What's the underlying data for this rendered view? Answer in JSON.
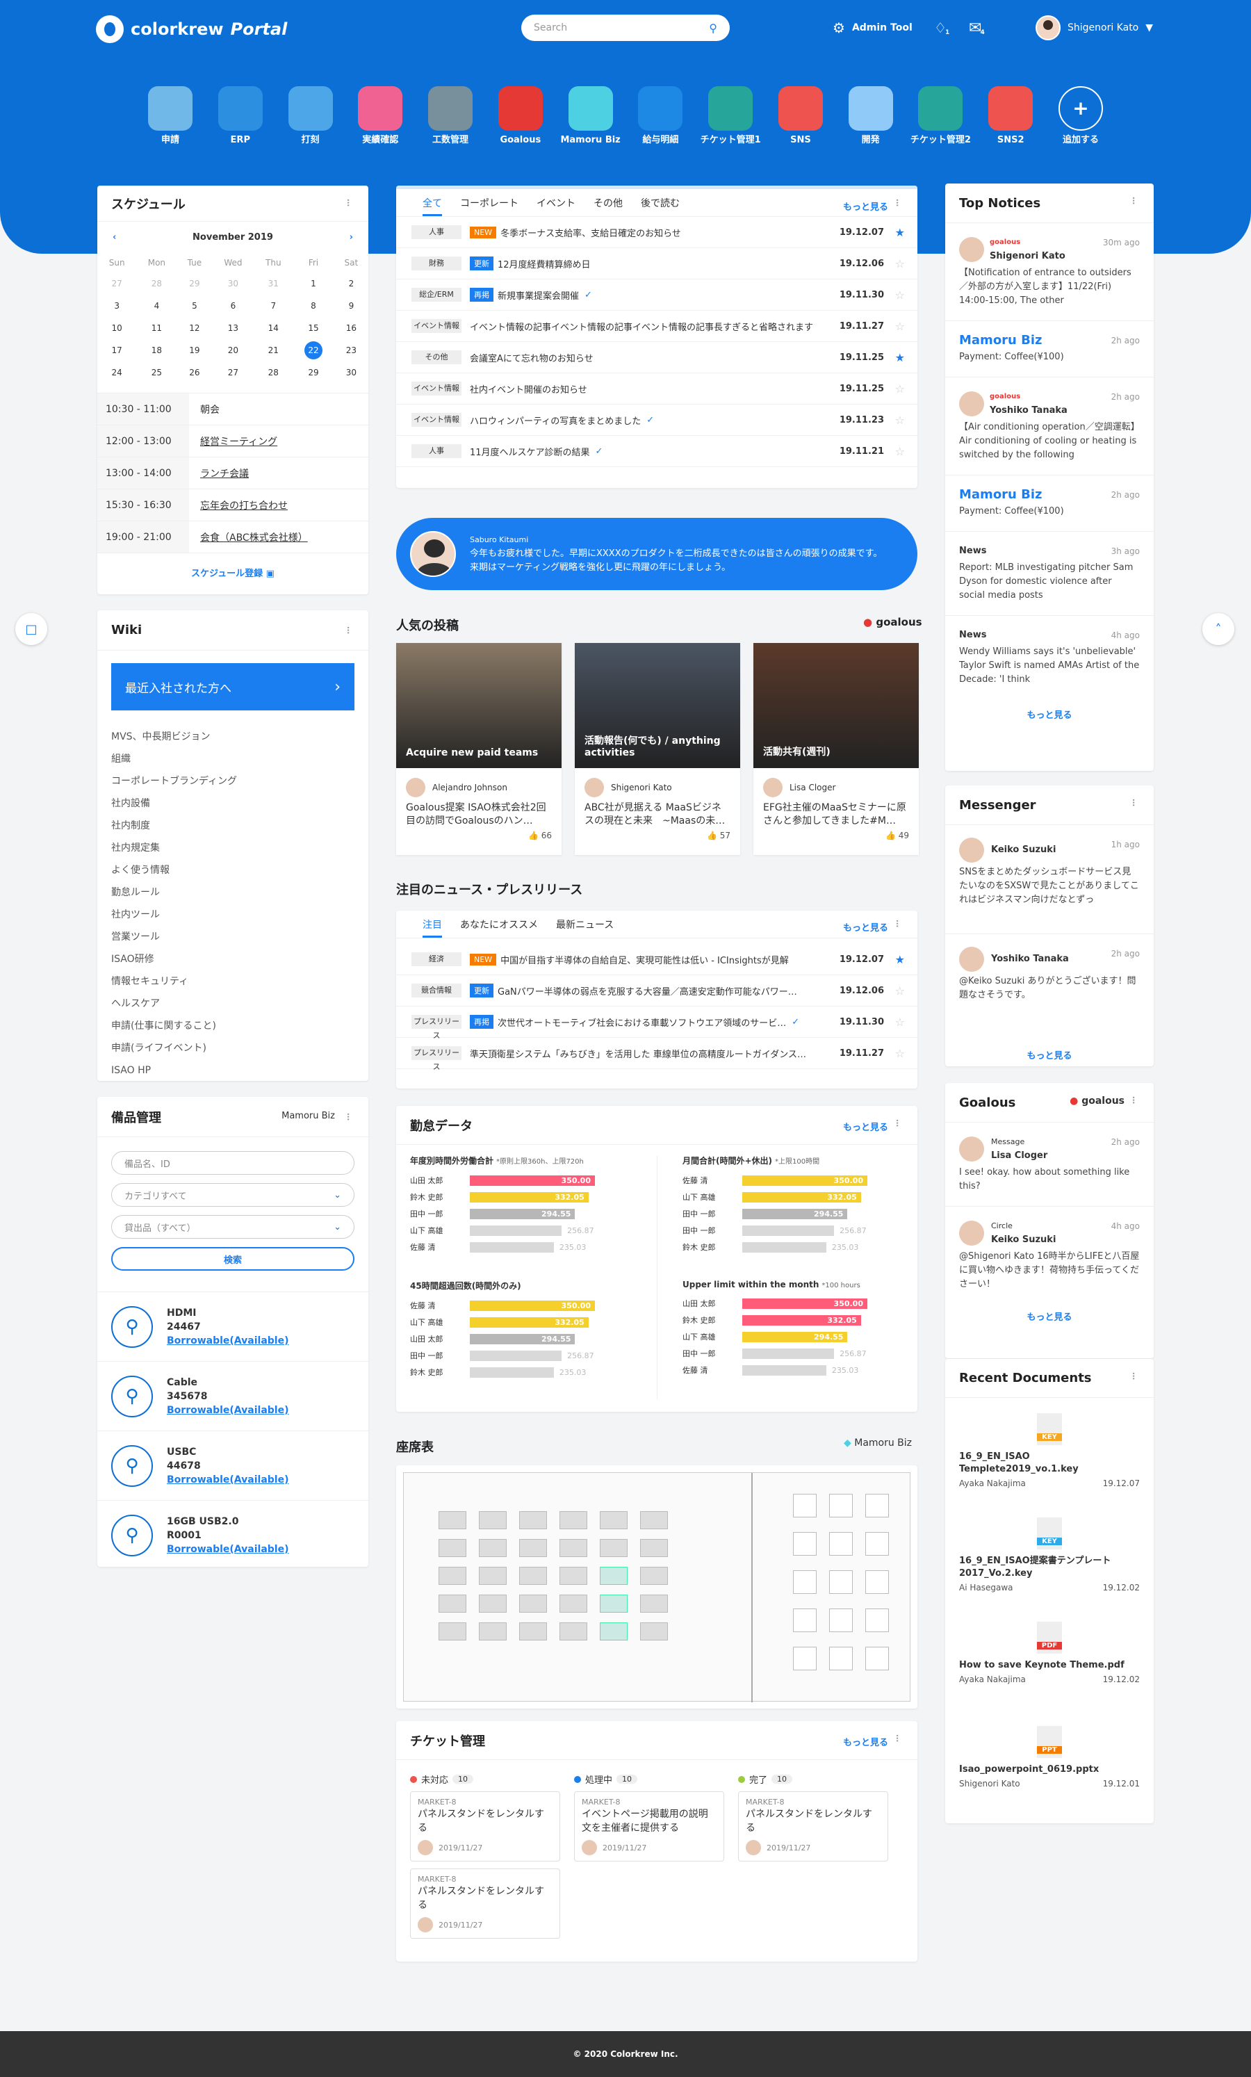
{
  "header": {
    "logo": "colorkrew",
    "logo_suffix": "Portal",
    "search_placeholder": "Search",
    "admin_tool": "Admin Tool",
    "notif_count": "1",
    "mail_count": "4",
    "user": "Shigenori Kato"
  },
  "apps": [
    {
      "label": "申請",
      "color": "#6fb8e8"
    },
    {
      "label": "ERP",
      "color": "#2d8fe0"
    },
    {
      "label": "打刻",
      "color": "#4da6e8"
    },
    {
      "label": "実績確認",
      "color": "#f06292"
    },
    {
      "label": "工数管理",
      "color": "#78909c"
    },
    {
      "label": "Goalous",
      "color": "#e53935"
    },
    {
      "label": "Mamoru Biz",
      "color": "#4dd0e1"
    },
    {
      "label": "給与明細",
      "color": "#1e88e5"
    },
    {
      "label": "チケット管理1",
      "color": "#26a69a"
    },
    {
      "label": "SNS",
      "color": "#ef5350"
    },
    {
      "label": "開発",
      "color": "#90caf9"
    },
    {
      "label": "チケット管理2",
      "color": "#26a69a"
    },
    {
      "label": "SNS2",
      "color": "#ef5350"
    },
    {
      "label": "追加する",
      "color": "transparent"
    }
  ],
  "schedule": {
    "title": "スケジュール",
    "month": "November 2019",
    "weekdays": [
      "Sun",
      "Mon",
      "Tue",
      "Wed",
      "Thu",
      "Fri",
      "Sat"
    ],
    "weeks": [
      [
        "27",
        "28",
        "29",
        "30",
        "31",
        "1",
        "2"
      ],
      [
        "3",
        "4",
        "5",
        "6",
        "7",
        "8",
        "9"
      ],
      [
        "10",
        "11",
        "12",
        "13",
        "14",
        "15",
        "16"
      ],
      [
        "17",
        "18",
        "19",
        "20",
        "21",
        "22",
        "23"
      ],
      [
        "24",
        "25",
        "26",
        "27",
        "28",
        "29",
        "30"
      ]
    ],
    "events": [
      {
        "time": "10:30 - 11:00",
        "title": "朝会"
      },
      {
        "time": "12:00 - 13:00",
        "title": "経営ミーティング"
      },
      {
        "time": "13:00 - 14:00",
        "title": "ランチ会議"
      },
      {
        "time": "15:30 - 16:30",
        "title": "忘年会の打ち合わせ"
      },
      {
        "time": "19:00 - 21:00",
        "title": "会食（ABC株式会社様）"
      }
    ],
    "register": "スケジュール登録"
  },
  "wiki": {
    "title": "Wiki",
    "banner": "最近入社された方へ",
    "items": [
      "MVS、中長期ビジョン",
      "組織",
      "コーポレートブランディング",
      "社内設備",
      "社内制度",
      "社内規定集",
      "よく使う情報",
      "勤怠ルール",
      "社内ツール",
      "営業ツール",
      "ISAO研修",
      "情報セキュリティ",
      "ヘルスケア",
      "申請(仕事に関すること)",
      "申請(ライフイベント)",
      "ISAO HP"
    ]
  },
  "equipment": {
    "title": "備品管理",
    "brand": "Mamoru Biz",
    "name_placeholder": "備品名、ID",
    "category": "カテゴリすべて",
    "rental": "貸出品（すべて）",
    "search": "検索",
    "items": [
      {
        "name": "HDMI",
        "id": "24467",
        "status": "Borrowable(Available)"
      },
      {
        "name": "Cable",
        "id": "345678",
        "status": "Borrowable(Available)"
      },
      {
        "name": "USBC",
        "id": "44678",
        "status": "Borrowable(Available)"
      },
      {
        "name": "16GB USB2.0",
        "id": "R0001",
        "status": "Borrowable(Available)"
      }
    ]
  },
  "news": {
    "tabs": [
      "全て",
      "コーポレート",
      "イベント",
      "その他",
      "後で読む"
    ],
    "more": "もっと見る",
    "rows": [
      {
        "cat": "人事",
        "badge": "NEW",
        "badge_color": "#f57c00",
        "text": "冬季ボーナス支給率、支給日確定のお知らせ",
        "date": "19.12.07",
        "star": true,
        "check": false
      },
      {
        "cat": "財務",
        "badge": "更新",
        "badge_color": "#1b7ef0",
        "text": "12月度経費精算締め日",
        "date": "19.12.06",
        "star": false,
        "check": false
      },
      {
        "cat": "総企/ERM",
        "badge": "再掲",
        "badge_color": "#1b7ef0",
        "text": "新規事業提案会開催",
        "date": "19.11.30",
        "star": false,
        "check": true
      },
      {
        "cat": "イベント情報",
        "badge": "",
        "badge_color": "",
        "text": "イベント情報の記事イベント情報の記事イベント情報の記事長すぎると省略されます",
        "date": "19.11.27",
        "star": false,
        "check": false
      },
      {
        "cat": "その他",
        "badge": "",
        "badge_color": "",
        "text": "会議室Aにて忘れ物のお知らせ",
        "date": "19.11.25",
        "star": true,
        "check": false
      },
      {
        "cat": "イベント情報",
        "badge": "",
        "badge_color": "",
        "text": "社内イベント開催のお知らせ",
        "date": "19.11.25",
        "star": false,
        "check": false
      },
      {
        "cat": "イベント情報",
        "badge": "",
        "badge_color": "",
        "text": "ハロウィンパーティの写真をまとめました",
        "date": "19.11.23",
        "star": false,
        "check": true
      },
      {
        "cat": "人事",
        "badge": "",
        "badge_color": "",
        "text": "11月度ヘルスケア診断の結果",
        "date": "19.11.21",
        "star": false,
        "check": true
      }
    ]
  },
  "message": {
    "name": "Saburo Kitaumi",
    "text": "今年もお疲れ様でした。早期にXXXXのプロダクトを二桁成長できたのは皆さんの頑張りの成果です。来期はマーケティング戦略を強化し更に飛躍の年にしましょう。"
  },
  "popular": {
    "title": "人気の投稿",
    "brand": "goalous",
    "posts": [
      {
        "caption": "Acquire new paid teams",
        "author": "Alejandro Johnson",
        "body": "Goalous提案 ISAO株式会社2回目の訪問でGoalousのハン…",
        "likes": "66",
        "bg": "#8a7a66"
      },
      {
        "caption": "活動報告(何でも) / anything activities",
        "author": "Shigenori Kato",
        "body": "ABC社が見据える MaaSビジネスの現在と未来　~Maasの未…",
        "likes": "57",
        "bg": "#4b5563"
      },
      {
        "caption": "活動共有(週刊)",
        "author": "Lisa Cloger",
        "body": "EFG社主催のMaaSセミナーに原さんと参加してきました#M…",
        "likes": "49",
        "bg": "#5b3a2a"
      }
    ]
  },
  "press": {
    "title": "注目のニュース・プレスリリース",
    "tabs": [
      "注目",
      "あなたにオススメ",
      "最新ニュース"
    ],
    "more": "もっと見る",
    "rows": [
      {
        "cat": "経済",
        "badge": "NEW",
        "badge_color": "#f57c00",
        "text": "中国が目指す半導体の自給自足、実現可能性は低い - ICInsightsが見解",
        "date": "19.12.07",
        "star": true,
        "check": false
      },
      {
        "cat": "競合情報",
        "badge": "更新",
        "badge_color": "#1b7ef0",
        "text": "GaNパワー半導体の弱点を克服する大容量／高速安定動作可能なパワー…",
        "date": "19.12.06",
        "star": false,
        "check": false
      },
      {
        "cat": "プレスリリース",
        "badge": "再掲",
        "badge_color": "#1b7ef0",
        "text": "次世代オートモーティブ社会における車載ソフトウエア領域のサービ…",
        "date": "19.11.30",
        "star": false,
        "check": true
      },
      {
        "cat": "プレスリリース",
        "badge": "",
        "badge_color": "",
        "text": "準天頂衛星システム「みちびき」を活用した 車線単位の高精度ルートガイダンス…",
        "date": "19.11.27",
        "star": false,
        "check": false
      }
    ]
  },
  "attendance": {
    "title": "勤怠データ",
    "more": "もっと見る",
    "groups": [
      {
        "title": "年度別時間外労働合計",
        "note": "*原則上限360h、上限720h",
        "rows": [
          {
            "name": "山田 太郎",
            "value": 350.0,
            "color": "#ff5c7a"
          },
          {
            "name": "鈴木 史郎",
            "value": 332.05,
            "color": "#f5d02c"
          },
          {
            "name": "田中 一郎",
            "value": 294.55,
            "color": "#b7b7b7"
          },
          {
            "name": "山下 高雄",
            "value": 256.87,
            "color": "#d9d9d9"
          },
          {
            "name": "佐藤 清",
            "value": 235.03,
            "color": "#d9d9d9"
          }
        ]
      },
      {
        "title": "月間合計(時間外+休出)",
        "note": "*上限100時間",
        "rows": [
          {
            "name": "佐藤 清",
            "value": 350.0,
            "color": "#f5d02c"
          },
          {
            "name": "山下 高雄",
            "value": 332.05,
            "color": "#f5d02c"
          },
          {
            "name": "田中 一郎",
            "value": 294.55,
            "color": "#b7b7b7"
          },
          {
            "name": "田中 一郎",
            "value": 256.87,
            "color": "#d9d9d9"
          },
          {
            "name": "鈴木 史郎",
            "value": 235.03,
            "color": "#d9d9d9"
          }
        ]
      },
      {
        "title": "45時間超過回数(時間外のみ)",
        "note": "",
        "rows": [
          {
            "name": "佐藤 清",
            "value": 350.0,
            "color": "#f5d02c"
          },
          {
            "name": "山下 高雄",
            "value": 332.05,
            "color": "#f5d02c"
          },
          {
            "name": "山田 太郎",
            "value": 294.55,
            "color": "#b7b7b7"
          },
          {
            "name": "田中 一郎",
            "value": 256.87,
            "color": "#d9d9d9"
          },
          {
            "name": "鈴木 史郎",
            "value": 235.03,
            "color": "#d9d9d9"
          }
        ]
      },
      {
        "title": "Upper limit within the month",
        "note": "*100 hours",
        "rows": [
          {
            "name": "山田 太郎",
            "value": 350.0,
            "color": "#ff5c7a"
          },
          {
            "name": "鈴木 史郎",
            "value": 332.05,
            "color": "#ff5c7a"
          },
          {
            "name": "山下 高雄",
            "value": 294.55,
            "color": "#f5d02c"
          },
          {
            "name": "田中 一郎",
            "value": 256.87,
            "color": "#d9d9d9"
          },
          {
            "name": "佐藤 清",
            "value": 235.03,
            "color": "#d9d9d9"
          }
        ]
      }
    ]
  },
  "seating": {
    "title": "座席表",
    "brand": "Mamoru Biz"
  },
  "tickets": {
    "title": "チケット管理",
    "more": "もっと見る",
    "columns": [
      {
        "label": "未対応",
        "count": "10",
        "color": "#ef5350",
        "cards": [
          {
            "key": "MARKET-8",
            "title": "パネルスタンドをレンタルする",
            "date": "2019/11/27"
          },
          {
            "key": "MARKET-8",
            "title": "パネルスタンドをレンタルする",
            "date": "2019/11/27"
          }
        ]
      },
      {
        "label": "処理中",
        "count": "10",
        "color": "#1b7ef0",
        "cards": [
          {
            "key": "MARKET-8",
            "title": "イベントページ掲載用の説明文を主催者に提供する",
            "date": "2019/11/27"
          }
        ]
      },
      {
        "label": "完了",
        "count": "10",
        "color": "#9ccc3d",
        "cards": [
          {
            "key": "MARKET-8",
            "title": "パネルスタンドをレンタルする",
            "date": "2019/11/27"
          }
        ]
      }
    ]
  },
  "notices": {
    "title": "Top Notices",
    "more": "もっと見る",
    "items": [
      {
        "source": "goalous",
        "author": "Shigenori Kato",
        "time": "30m ago",
        "text": "【Notification of entrance to outsiders／外部の方が入室します】11/22(Fri) 14:00-15:00, The other"
      },
      {
        "source": "Mamoru Biz",
        "author": "",
        "time": "2h ago",
        "text": "Payment: Coffee(¥100)"
      },
      {
        "source": "goalous",
        "author": "Yoshiko Tanaka",
        "time": "2h ago",
        "text": "【Air conditioning operation／空調運転】 Air conditioning of cooling or heating is switched by the following"
      },
      {
        "source": "Mamoru Biz",
        "author": "",
        "time": "2h ago",
        "text": "Payment: Coffee(¥100)"
      },
      {
        "source": "News",
        "author": "",
        "time": "3h ago",
        "text": "Report: MLB investigating pitcher Sam Dyson for domestic violence after social media posts"
      },
      {
        "source": "News",
        "author": "",
        "time": "4h ago",
        "text": "Wendy Williams says it's 'unbelievable' Taylor Swift is named AMAs Artist of the Decade: 'I think"
      }
    ]
  },
  "messenger": {
    "title": "Messenger",
    "more": "もっと見る",
    "items": [
      {
        "name": "Keiko Suzuki",
        "time": "1h ago",
        "text": "SNSをまとめたダッシュボードサービス見たいなのをSXSWで見たことがありましてこれはビジネスマン向けだなとずっ"
      },
      {
        "name": "Yoshiko Tanaka",
        "time": "2h ago",
        "text": "@Keiko Suzuki ありがとうございます！問題なさそうです。"
      }
    ]
  },
  "goalous": {
    "title": "Goalous",
    "brand": "goalous",
    "more": "もっと見る",
    "items": [
      {
        "kind": "Message",
        "name": "Lisa Cloger",
        "time": "2h ago",
        "text": "I see! okay. how about something like this?"
      },
      {
        "kind": "Circle",
        "name": "Keiko Suzuki",
        "time": "4h ago",
        "text": "@Shigenori Kato 16時半からLIFEと八百屋に買い物へゆきます！荷物持ち手伝ってくださーい！"
      }
    ]
  },
  "documents": {
    "title": "Recent Documents",
    "items": [
      {
        "type": "KEY",
        "name": "16_9_EN_ISAO Templete2019_vo.1.key",
        "user": "Ayaka Nakajima",
        "date": "19.12.07",
        "color": "#f5a623"
      },
      {
        "type": "KEY",
        "name": "16_9_EN_ISAO提案書テンプレート2017_Vo.2.key",
        "user": "Ai Hasegawa",
        "date": "19.12.02",
        "color": "#2fa9e8"
      },
      {
        "type": "PDF",
        "name": "How to save Keynote Theme.pdf",
        "user": "Ayaka Nakajima",
        "date": "19.12.02",
        "color": "#e53935"
      },
      {
        "type": "PPT",
        "name": "Isao_powerpoint_0619.pptx",
        "user": "Shigenori Kato",
        "date": "19.12.01",
        "color": "#f57c00"
      }
    ]
  },
  "footer": "© 2020 Colorkrew Inc."
}
